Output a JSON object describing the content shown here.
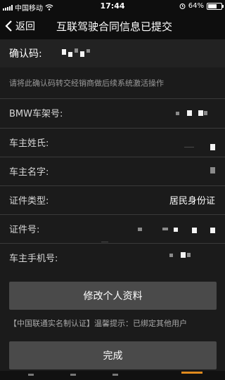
{
  "status_bar": {
    "carrier": "中国移动",
    "time": "17:44",
    "battery": "64%",
    "battery_level": 0.64
  },
  "nav": {
    "back_label": "返回",
    "title": "互联驾驶合同信息已提交"
  },
  "confirm": {
    "label": "确认码:",
    "hint": "请将此确认码转交经销商做后续系统激活操作"
  },
  "fields": [
    {
      "label": "BMW车架号:",
      "value": ""
    },
    {
      "label": "车主姓氏:",
      "value": ""
    },
    {
      "label": "车主名字:",
      "value": ""
    },
    {
      "label": "证件类型:",
      "value": "居民身份证"
    },
    {
      "label": "证件号:",
      "value": ""
    },
    {
      "label": "车主手机号:",
      "value": ""
    }
  ],
  "buttons": {
    "edit_profile": "修改个人资料",
    "done": "完成"
  },
  "notice": "【中国联通实名制认证】温馨提示：已绑定其他用户"
}
